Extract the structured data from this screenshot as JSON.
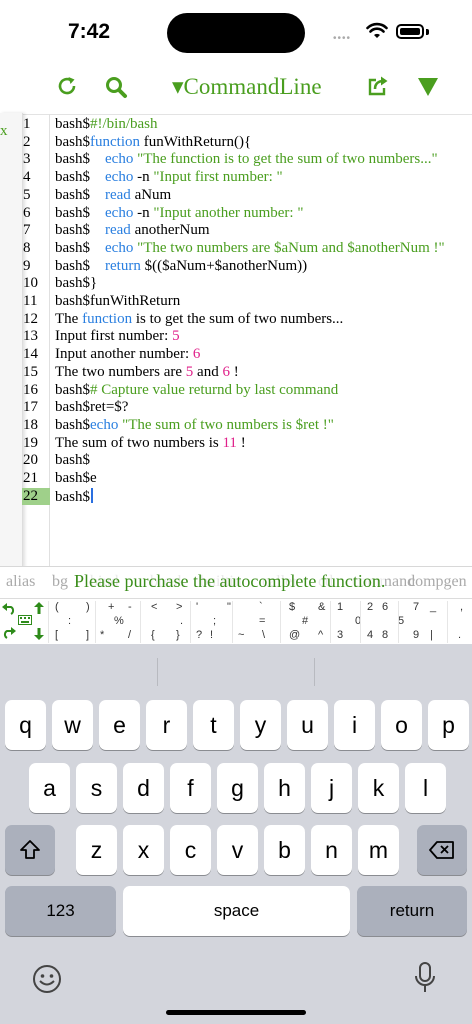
{
  "status": {
    "time": "7:42",
    "dots": "••••"
  },
  "toolbar": {
    "title": "▾CommandLine",
    "icons": [
      "refresh-icon",
      "search-icon",
      "share-icon",
      "triangle-down-icon"
    ],
    "accent": "#4a9e1f"
  },
  "side_panel": {
    "close": "x"
  },
  "editor": {
    "lines": [
      {
        "n": "1",
        "parts": [
          [
            "p",
            "bash$"
          ],
          [
            "s",
            "#!/bin/bash"
          ]
        ]
      },
      {
        "n": "2",
        "parts": [
          [
            "p",
            "bash$"
          ],
          [
            "k",
            "function"
          ],
          [
            "p",
            " funWithReturn(){"
          ]
        ]
      },
      {
        "n": "3",
        "parts": [
          [
            "p",
            "bash$    "
          ],
          [
            "k",
            "echo"
          ],
          [
            "p",
            " "
          ],
          [
            "s",
            "\"The function is to get the sum of two numbers...\""
          ]
        ]
      },
      {
        "n": "4",
        "parts": [
          [
            "p",
            "bash$    "
          ],
          [
            "k",
            "echo"
          ],
          [
            "p",
            " -n "
          ],
          [
            "s",
            "\"Input first number: \""
          ]
        ]
      },
      {
        "n": "5",
        "parts": [
          [
            "p",
            "bash$    "
          ],
          [
            "k",
            "read"
          ],
          [
            "p",
            " aNum"
          ]
        ]
      },
      {
        "n": "6",
        "parts": [
          [
            "p",
            "bash$    "
          ],
          [
            "k",
            "echo"
          ],
          [
            "p",
            " -n "
          ],
          [
            "s",
            "\"Input another number: \""
          ]
        ]
      },
      {
        "n": "7",
        "parts": [
          [
            "p",
            "bash$    "
          ],
          [
            "k",
            "read"
          ],
          [
            "p",
            " anotherNum"
          ]
        ]
      },
      {
        "n": "8",
        "parts": [
          [
            "p",
            "bash$    "
          ],
          [
            "k",
            "echo"
          ],
          [
            "p",
            " "
          ],
          [
            "s",
            "\"The two numbers are $aNum and $anotherNum !\""
          ]
        ]
      },
      {
        "n": "9",
        "parts": [
          [
            "p",
            "bash$    "
          ],
          [
            "k",
            "return"
          ],
          [
            "p",
            " $(($aNum+$anotherNum))"
          ]
        ]
      },
      {
        "n": "10",
        "parts": [
          [
            "p",
            "bash$}"
          ]
        ]
      },
      {
        "n": "11",
        "parts": [
          [
            "p",
            "bash$funWithReturn"
          ]
        ]
      },
      {
        "n": "12",
        "parts": [
          [
            "p",
            "The "
          ],
          [
            "k",
            "function"
          ],
          [
            "p",
            " is to get the sum of two numbers..."
          ]
        ]
      },
      {
        "n": "13",
        "parts": [
          [
            "p",
            "Input first number: "
          ],
          [
            "n",
            "5"
          ]
        ]
      },
      {
        "n": "14",
        "parts": [
          [
            "p",
            "Input another number: "
          ],
          [
            "n",
            "6"
          ]
        ]
      },
      {
        "n": "15",
        "parts": [
          [
            "p",
            "The two numbers are "
          ],
          [
            "n",
            "5"
          ],
          [
            "p",
            " and "
          ],
          [
            "n",
            "6"
          ],
          [
            "p",
            " !"
          ]
        ]
      },
      {
        "n": "16",
        "parts": [
          [
            "p",
            "bash$"
          ],
          [
            "s",
            "# Capture value returnd by last command"
          ]
        ]
      },
      {
        "n": "17",
        "parts": [
          [
            "p",
            "bash$ret=$?"
          ]
        ]
      },
      {
        "n": "18",
        "parts": [
          [
            "p",
            "bash$"
          ],
          [
            "k",
            "echo"
          ],
          [
            "p",
            " "
          ],
          [
            "s",
            "\"The sum of two numbers is $ret !\""
          ]
        ]
      },
      {
        "n": "19",
        "parts": [
          [
            "p",
            "The sum of two numbers is "
          ],
          [
            "n",
            "11"
          ],
          [
            "p",
            " !"
          ]
        ]
      },
      {
        "n": "20",
        "parts": [
          [
            "p",
            "bash$"
          ]
        ]
      },
      {
        "n": "21",
        "parts": [
          [
            "p",
            "bash$e"
          ]
        ]
      },
      {
        "n": "22",
        "parts": [
          [
            "p",
            "bash$"
          ]
        ],
        "active": true
      }
    ]
  },
  "suggestions": {
    "chips": [
      "alias",
      "bg",
      "bind",
      "break",
      "builtin",
      "caller",
      "cd",
      "command",
      "compgen"
    ],
    "banner": "Please purchase the autocomplete function."
  },
  "symbol_row_top": [
    "(",
    ")",
    "+",
    "-",
    "<",
    ">",
    "'",
    "\"",
    "`",
    "$",
    "&",
    "1",
    "2",
    "6",
    "7",
    "_",
    ","
  ],
  "symbol_row_bottom": [
    "[",
    "]",
    "*",
    "/",
    "{",
    "}",
    "?",
    "!",
    "~",
    "\\",
    "@",
    "^",
    "3",
    "4",
    "8",
    "9",
    "|",
    "."
  ],
  "symbol_row_mid": [
    ":",
    "%",
    ".",
    ";",
    "=",
    "#",
    "0",
    "5"
  ],
  "keyboard": {
    "row1": [
      "q",
      "w",
      "e",
      "r",
      "t",
      "y",
      "u",
      "i",
      "o",
      "p"
    ],
    "row2": [
      "a",
      "s",
      "d",
      "f",
      "g",
      "h",
      "j",
      "k",
      "l"
    ],
    "row3": [
      "z",
      "x",
      "c",
      "v",
      "b",
      "n",
      "m"
    ],
    "numbers_label": "123",
    "space_label": "space",
    "return_label": "return"
  }
}
